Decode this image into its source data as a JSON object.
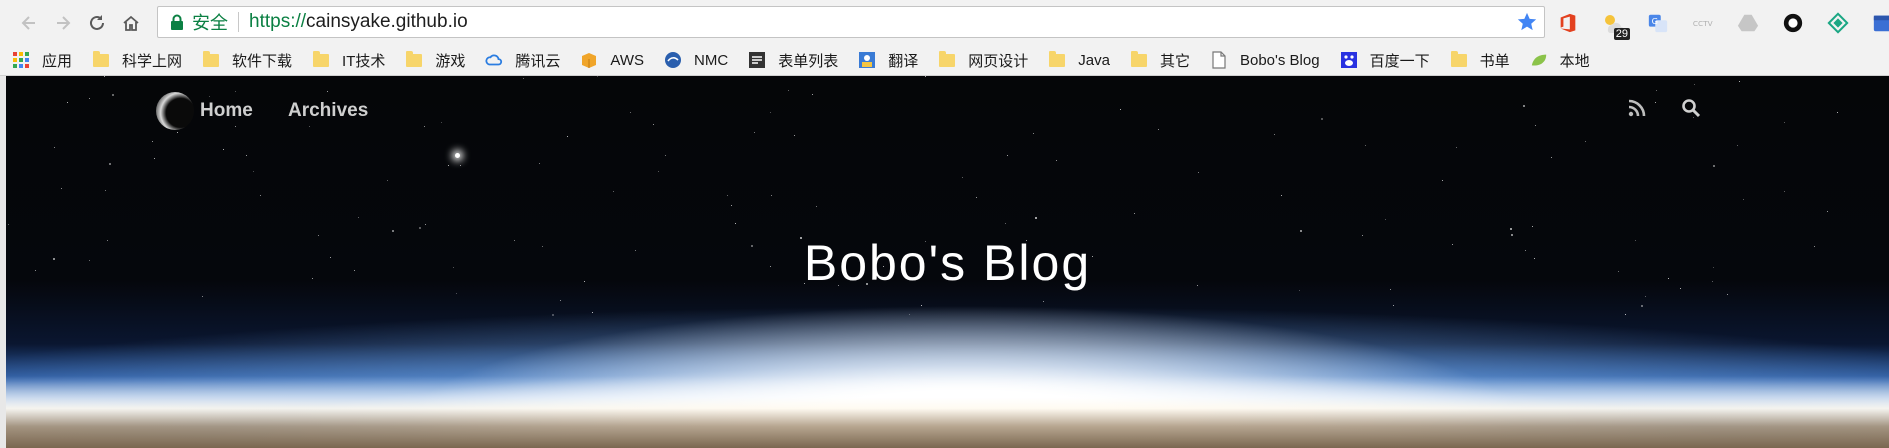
{
  "browser": {
    "secure_label": "安全",
    "url_scheme": "https://",
    "url_host": "cainsyake.github.io",
    "extensions": [
      {
        "name": "office-icon",
        "badge": ""
      },
      {
        "name": "weather-icon",
        "badge": "29"
      },
      {
        "name": "translate-icon",
        "badge": ""
      },
      {
        "name": "cctv-icon",
        "badge": ""
      },
      {
        "name": "drive-icon",
        "badge": ""
      },
      {
        "name": "circle-icon",
        "badge": ""
      },
      {
        "name": "diamond-icon",
        "badge": ""
      },
      {
        "name": "calendar-icon",
        "badge": ""
      }
    ]
  },
  "bookmarks": [
    {
      "label": "应用",
      "icon": "apps-grid-icon"
    },
    {
      "label": "科学上网",
      "icon": "folder-icon"
    },
    {
      "label": "软件下载",
      "icon": "folder-icon"
    },
    {
      "label": "IT技术",
      "icon": "folder-icon"
    },
    {
      "label": "游戏",
      "icon": "folder-icon"
    },
    {
      "label": "腾讯云",
      "icon": "cloud-icon"
    },
    {
      "label": "AWS",
      "icon": "aws-icon"
    },
    {
      "label": "NMC",
      "icon": "nmc-icon"
    },
    {
      "label": "表单列表",
      "icon": "form-icon"
    },
    {
      "label": "翻译",
      "icon": "translate-icon"
    },
    {
      "label": "网页设计",
      "icon": "folder-icon"
    },
    {
      "label": "Java",
      "icon": "folder-icon"
    },
    {
      "label": "其它",
      "icon": "folder-icon"
    },
    {
      "label": "Bobo's Blog",
      "icon": "page-icon"
    },
    {
      "label": "百度一下",
      "icon": "baidu-icon"
    },
    {
      "label": "书单",
      "icon": "folder-icon"
    },
    {
      "label": "本地",
      "icon": "leaf-icon"
    }
  ],
  "site": {
    "nav": {
      "home": "Home",
      "archives": "Archives"
    },
    "title": "Bobo's Blog"
  },
  "colors": {
    "secure_green": "#0b8043",
    "star_blue": "#4285f4",
    "folder_yellow": "#f7d56a"
  }
}
